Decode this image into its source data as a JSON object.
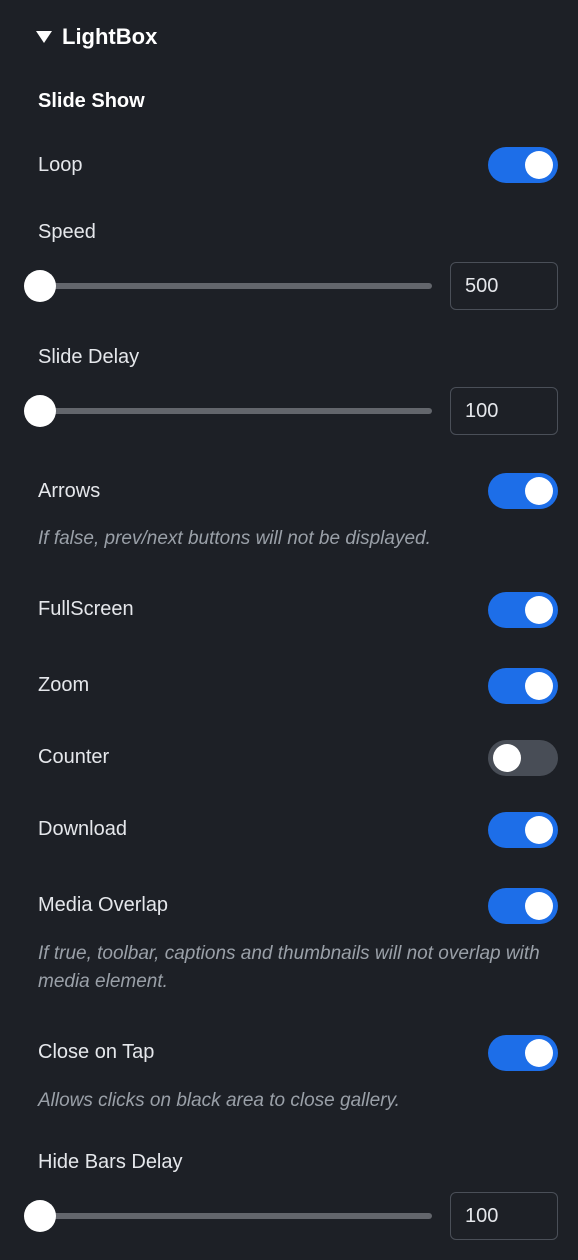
{
  "section": {
    "title": "LightBox"
  },
  "slideshow": {
    "group_title": "Slide Show",
    "loop": {
      "label": "Loop",
      "on": true
    },
    "speed": {
      "label": "Speed",
      "value": "500"
    },
    "slide_delay": {
      "label": "Slide Delay",
      "value": "100"
    },
    "arrows": {
      "label": "Arrows",
      "on": true,
      "note": "If false, prev/next buttons will not be displayed."
    },
    "fullscreen": {
      "label": "FullScreen",
      "on": true
    },
    "zoom": {
      "label": "Zoom",
      "on": true
    },
    "counter": {
      "label": "Counter",
      "on": false
    },
    "download": {
      "label": "Download",
      "on": true
    },
    "media_overlap": {
      "label": "Media Overlap",
      "on": true,
      "note": "If true, toolbar, captions and thumbnails will not overlap with media element."
    },
    "close_on_tap": {
      "label": "Close on Tap",
      "on": true,
      "note": "Allows clicks on black area to close gallery."
    },
    "hide_bars_delay": {
      "label": "Hide Bars Delay",
      "value": "100"
    }
  }
}
